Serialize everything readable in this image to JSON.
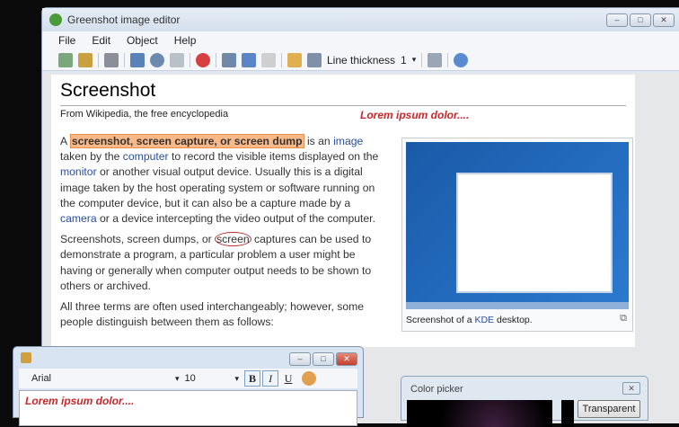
{
  "window": {
    "title": "Greenshot image editor",
    "min": "–",
    "max": "□",
    "close": "✕"
  },
  "menu": [
    "File",
    "Edit",
    "Object",
    "Help"
  ],
  "toolbar": {
    "line_thickness_label": "Line thickness",
    "line_thickness_value": "1",
    "dropdown": "▾"
  },
  "article": {
    "title": "Screenshot",
    "subtitle": "From Wikipedia, the free encyclopedia",
    "annotation": "Lorem ipsum dolor....",
    "paragraphs": [
      [
        [
          "A ",
          ""
        ],
        [
          "screenshot, screen capture, or screen dump",
          "hl"
        ],
        [
          " is an ",
          ""
        ],
        [
          "image",
          "lnk"
        ],
        [
          " taken by the ",
          ""
        ],
        [
          "computer",
          "lnk"
        ],
        [
          " to record the visible items displayed on the ",
          ""
        ],
        [
          "monitor",
          "lnk"
        ],
        [
          " or another visual output device. Usually this is a digital image taken by the host operating system or software running on the computer device, but it can also be a capture made by a ",
          ""
        ],
        [
          "camera",
          "lnk"
        ],
        [
          " or a device intercepting the video output of the computer.",
          ""
        ]
      ],
      [
        [
          "Screenshots, screen dumps, or ",
          ""
        ],
        [
          "screen",
          "circ"
        ],
        [
          " captures can be used to demonstrate a program, a particular problem a user might be having or generally when computer output needs to be shown to others or archived.",
          ""
        ]
      ],
      [
        [
          "All three terms are often used interchangeably; however, some people distinguish between them as follows:",
          ""
        ]
      ]
    ],
    "thumb_caption_pre": "Screenshot of a ",
    "thumb_caption_link": "KDE",
    "thumb_caption_post": " desktop."
  },
  "text_window": {
    "font": "Arial",
    "size": "10",
    "bold": "B",
    "italic": "I",
    "underline": "U",
    "content": "Lorem ipsum dolor....",
    "dropdown": "▾"
  },
  "color_picker": {
    "title": "Color picker",
    "close": "✕",
    "transparent": "Transparent"
  }
}
